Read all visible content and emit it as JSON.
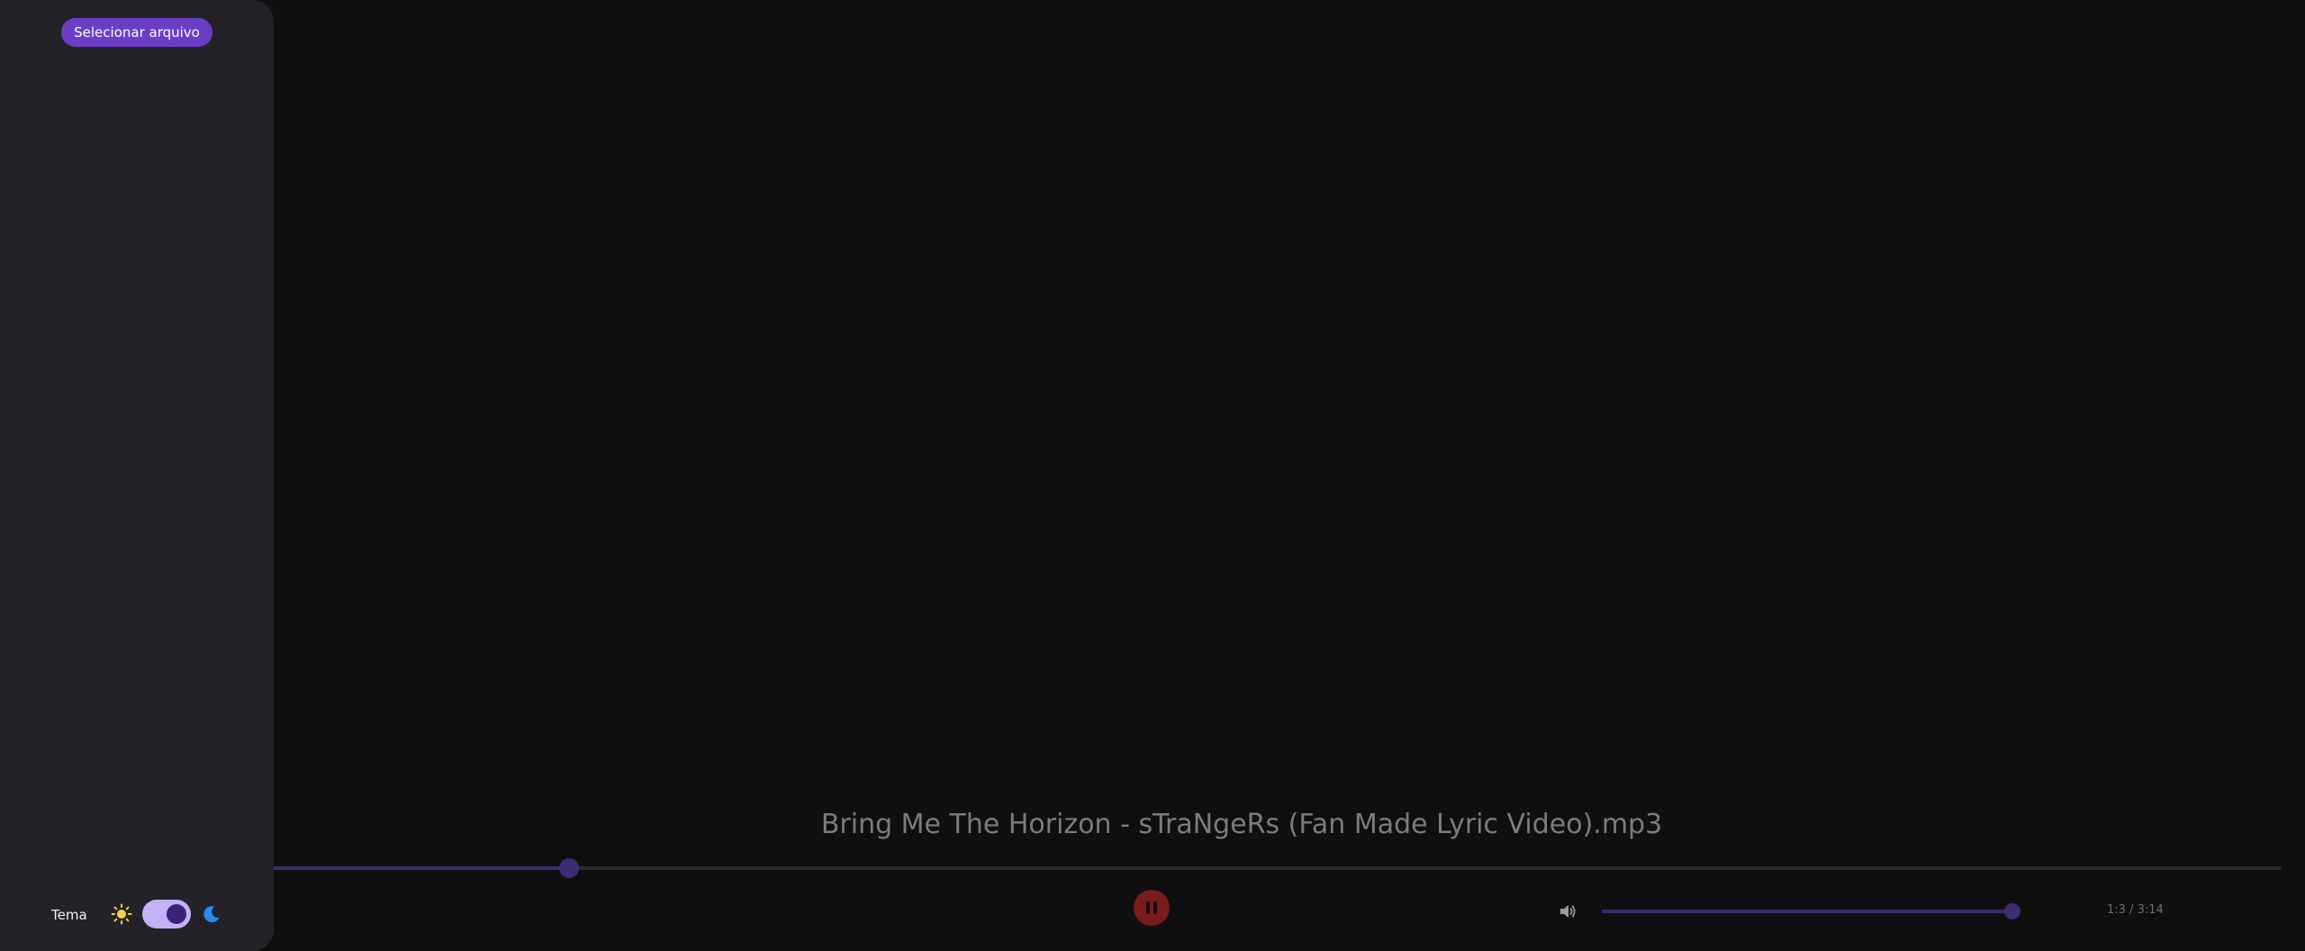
{
  "sidebar": {
    "select_file_label": "Selecionar arquivo",
    "theme_label": "Tema",
    "theme_toggle": {
      "state": "dark",
      "sun_icon": "sun-icon",
      "moon_icon": "moon-icon"
    }
  },
  "player": {
    "track_title": "Bring Me The Horizon - sTraNgeRs (Fan Made Lyric Video).mp3",
    "progress_fraction": 0.147,
    "volume_fraction": 0.98,
    "time_display": "1:3 / 3:14",
    "play_state": "playing",
    "pause_icon": "pause-icon",
    "volume_icon": "volume-icon"
  },
  "colors": {
    "accent": "#6a3fc6",
    "track_fill": "#3a2a6b",
    "pause_button": "#7a1c1c",
    "sun": "#f5d142",
    "moon": "#2a8cf0"
  }
}
